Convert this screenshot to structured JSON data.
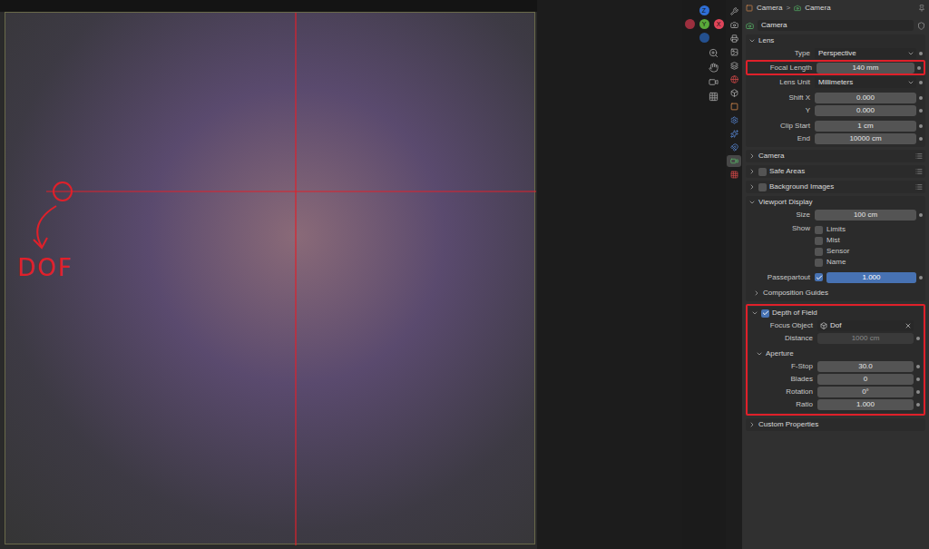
{
  "viewport": {
    "annotation": {
      "text": "DOF"
    },
    "gizmo": [
      {
        "label": "Z",
        "color": "#2f6fd6"
      },
      {
        "label": "",
        "color": "#9c2f3e"
      },
      {
        "label": "Y",
        "color": "#5aa83a"
      },
      {
        "label": "X",
        "color": "#e0455a"
      },
      {
        "label": "",
        "color": "#24508f"
      }
    ]
  },
  "tab_strip": [
    {
      "selected": false,
      "color": "#b4b4b4"
    },
    {
      "selected": false,
      "color": "#b4b4b4"
    },
    {
      "selected": false,
      "color": "#b4b4b4"
    },
    {
      "selected": false,
      "color": "#b4b4b4"
    },
    {
      "selected": false,
      "color": "#b4b4b4"
    },
    {
      "selected": false,
      "color": "#d04848"
    },
    {
      "selected": false,
      "color": "#b4b4b4"
    },
    {
      "selected": false,
      "color": "#e09050"
    },
    {
      "selected": false,
      "color": "#5a8ad8"
    },
    {
      "selected": false,
      "color": "#5a8ad8"
    },
    {
      "selected": false,
      "color": "#5a8ad8"
    },
    {
      "selected": true,
      "color": "#58b868"
    },
    {
      "selected": false,
      "color": "#d04848"
    }
  ],
  "properties": {
    "breadcrumb": [
      "Camera",
      "Camera"
    ],
    "separator": ">",
    "data_name": "Camera",
    "sections": [
      {
        "title": "Lens",
        "kind": "plain",
        "expanded": true,
        "presets": false,
        "highlighted": false,
        "groups": [
          [
            {
              "kind": "dropdown",
              "label": "Type",
              "value": "Perspective",
              "highlighted": false
            },
            {
              "kind": "number",
              "label": "Focal Length",
              "value": "140 mm",
              "highlighted": true,
              "disabled": false
            },
            {
              "kind": "dropdown",
              "label": "Lens Unit",
              "value": "Millimeters",
              "highlighted": false
            }
          ],
          [
            {
              "kind": "number",
              "label": "Shift X",
              "value": "0.000",
              "highlighted": false,
              "disabled": false
            },
            {
              "kind": "number",
              "label": "Y",
              "value": "0.000",
              "highlighted": false,
              "disabled": false
            }
          ],
          [
            {
              "kind": "number",
              "label": "Clip Start",
              "value": "1 cm",
              "highlighted": false,
              "disabled": false
            },
            {
              "kind": "number",
              "label": "End",
              "value": "10000 cm",
              "highlighted": false,
              "disabled": false
            }
          ]
        ],
        "subsections": []
      },
      {
        "title": "Camera",
        "kind": "plain",
        "expanded": false,
        "presets": true,
        "highlighted": false,
        "groups": [],
        "subsections": []
      },
      {
        "title": "Safe Areas",
        "kind": "toggle",
        "checked": false,
        "expanded": false,
        "presets": true,
        "highlighted": false,
        "groups": [],
        "subsections": []
      },
      {
        "title": "Background Images",
        "kind": "toggle",
        "checked": false,
        "expanded": false,
        "presets": true,
        "highlighted": false,
        "groups": [],
        "subsections": []
      },
      {
        "title": "Viewport Display",
        "kind": "plain",
        "expanded": true,
        "presets": false,
        "highlighted": false,
        "groups": [
          [
            {
              "kind": "number",
              "label": "Size",
              "value": "100 cm",
              "highlighted": false,
              "disabled": false
            }
          ],
          [
            {
              "kind": "checkbox-group",
              "label": "Show",
              "options": [
                {
                  "label": "Limits",
                  "checked": false
                },
                {
                  "label": "Mist",
                  "checked": false
                },
                {
                  "label": "Sensor",
                  "checked": false
                },
                {
                  "label": "Name",
                  "checked": false
                }
              ]
            }
          ],
          [
            {
              "kind": "checkbox-slider",
              "label": "Passepartout",
              "checked": true,
              "value": "1.000",
              "level": 1.0
            }
          ]
        ],
        "subsections": [
          {
            "title": "Composition Guides",
            "expanded": false,
            "rows": []
          }
        ]
      },
      {
        "title": "Depth of Field",
        "kind": "toggle",
        "checked": true,
        "expanded": true,
        "presets": false,
        "highlighted": true,
        "groups": [
          [
            {
              "kind": "object",
              "label": "Focus Object",
              "value": "Dof"
            },
            {
              "kind": "number",
              "label": "Distance",
              "value": "1000 cm",
              "highlighted": false,
              "disabled": true
            }
          ]
        ],
        "subsections": [
          {
            "title": "Aperture",
            "expanded": true,
            "rows": [
              {
                "kind": "number",
                "label": "F-Stop",
                "value": "30.0",
                "highlighted": false,
                "disabled": false
              },
              {
                "kind": "number",
                "label": "Blades",
                "value": "0",
                "highlighted": false,
                "disabled": false
              },
              {
                "kind": "number",
                "label": "Rotation",
                "value": "0°",
                "highlighted": false,
                "disabled": false
              },
              {
                "kind": "number",
                "label": "Ratio",
                "value": "1.000",
                "highlighted": false,
                "disabled": false
              }
            ]
          }
        ]
      },
      {
        "title": "Custom Properties",
        "kind": "plain",
        "expanded": false,
        "presets": false,
        "highlighted": false,
        "groups": [],
        "subsections": []
      }
    ]
  }
}
